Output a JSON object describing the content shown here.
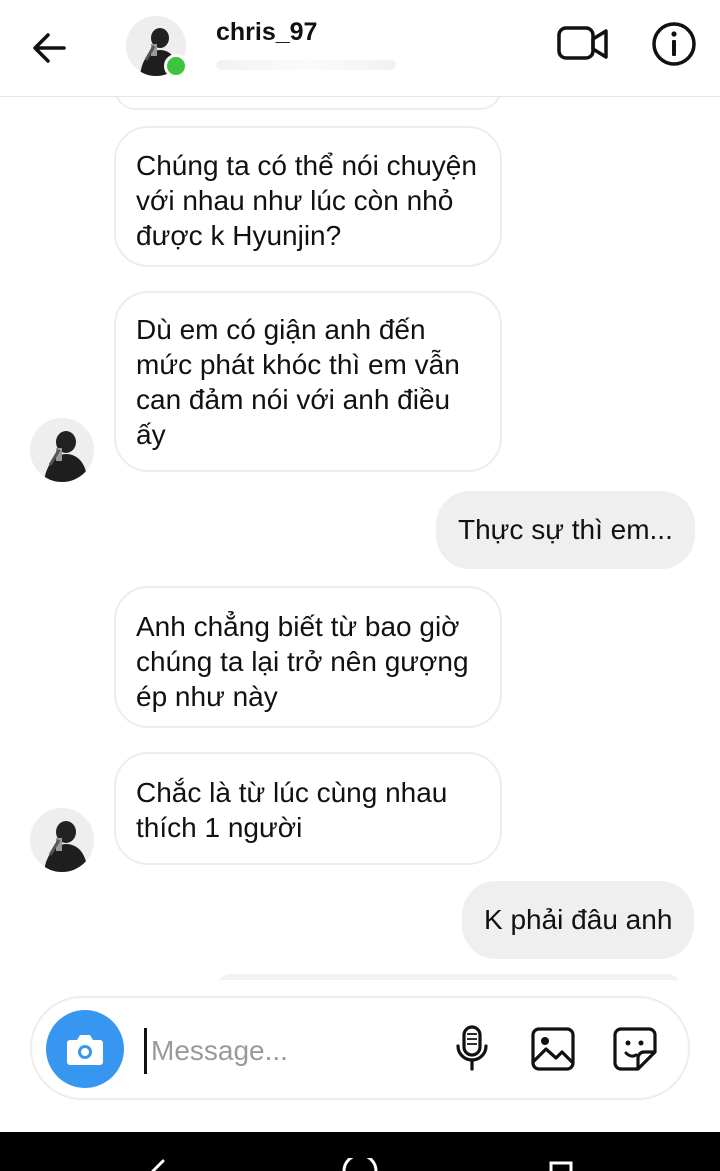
{
  "header": {
    "username": "chris_97",
    "icons": {
      "back": "arrow-left-icon",
      "video": "video-camera-icon",
      "info": "info-icon"
    },
    "online_color": "#3cc53c"
  },
  "messages": [
    {
      "side": "in",
      "text": "Chúng ta có thể nói chuyện với nhau như lúc còn nhỏ được k Hyunjin?"
    },
    {
      "side": "in",
      "text": "Dù em có giận anh đến mức phát khóc thì em vẫn can đảm nói với anh điều ấy"
    },
    {
      "side": "out",
      "text": "Thực sự thì em..."
    },
    {
      "side": "in",
      "text": "Anh chẳng biết từ bao giờ chúng ta lại trở nên gượng ép như này"
    },
    {
      "side": "in",
      "text": "Chắc là từ lúc cùng nhau thích 1 người"
    },
    {
      "side": "out",
      "text": "K phải đâu anh"
    }
  ],
  "composer": {
    "placeholder": "Message...",
    "accent": "#3797f0",
    "icons": [
      "camera-icon",
      "microphone-icon",
      "gallery-icon",
      "sticker-icon"
    ]
  }
}
